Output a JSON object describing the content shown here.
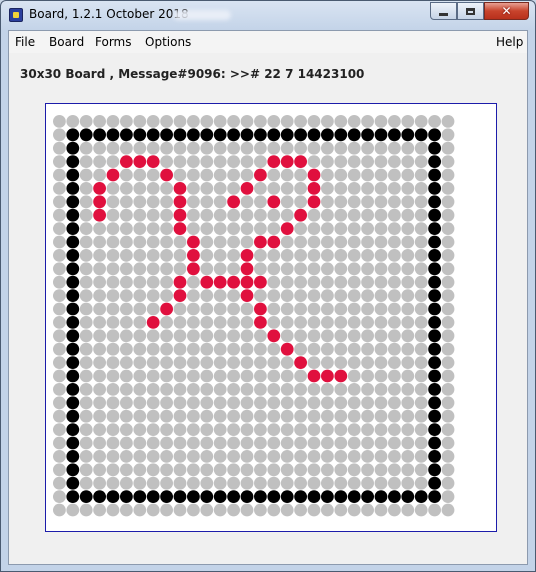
{
  "window": {
    "title": "Board, 1.2.1 October 2018",
    "minimize_icon": "minimize-icon",
    "maximize_icon": "maximize-icon",
    "close_icon": "close-icon"
  },
  "menubar": {
    "items": [
      "File",
      "Board",
      "Forms",
      "Options"
    ],
    "help": "Help"
  },
  "board": {
    "message": "30x30 Board , Message#9096: >># 22 7 14423100",
    "size": 30,
    "colors": {
      "empty": "#c0c0c0",
      "border": "#000000",
      "pattern": "#e0103e"
    },
    "pattern_cells": [
      [
        5,
        3
      ],
      [
        6,
        3
      ],
      [
        7,
        3
      ],
      [
        4,
        4
      ],
      [
        8,
        4
      ],
      [
        3,
        5
      ],
      [
        9,
        5
      ],
      [
        3,
        6
      ],
      [
        9,
        6
      ],
      [
        3,
        7
      ],
      [
        9,
        7
      ],
      [
        9,
        8
      ],
      [
        10,
        9
      ],
      [
        10,
        10
      ],
      [
        10,
        11
      ],
      [
        9,
        12
      ],
      [
        9,
        13
      ],
      [
        8,
        14
      ],
      [
        7,
        15
      ],
      [
        16,
        3
      ],
      [
        17,
        3
      ],
      [
        18,
        3
      ],
      [
        15,
        4
      ],
      [
        19,
        4
      ],
      [
        14,
        5
      ],
      [
        19,
        5
      ],
      [
        13,
        6
      ],
      [
        19,
        6
      ],
      [
        16,
        6
      ],
      [
        18,
        7
      ],
      [
        17,
        8
      ],
      [
        15,
        9
      ],
      [
        16,
        9
      ],
      [
        14,
        10
      ],
      [
        14,
        11
      ],
      [
        13,
        12
      ],
      [
        11,
        12
      ],
      [
        12,
        12
      ],
      [
        13,
        12
      ],
      [
        14,
        12
      ],
      [
        15,
        12
      ],
      [
        14,
        13
      ],
      [
        15,
        14
      ],
      [
        15,
        15
      ],
      [
        16,
        16
      ],
      [
        17,
        17
      ],
      [
        18,
        18
      ],
      [
        19,
        19
      ],
      [
        20,
        19
      ],
      [
        21,
        19
      ]
    ]
  }
}
